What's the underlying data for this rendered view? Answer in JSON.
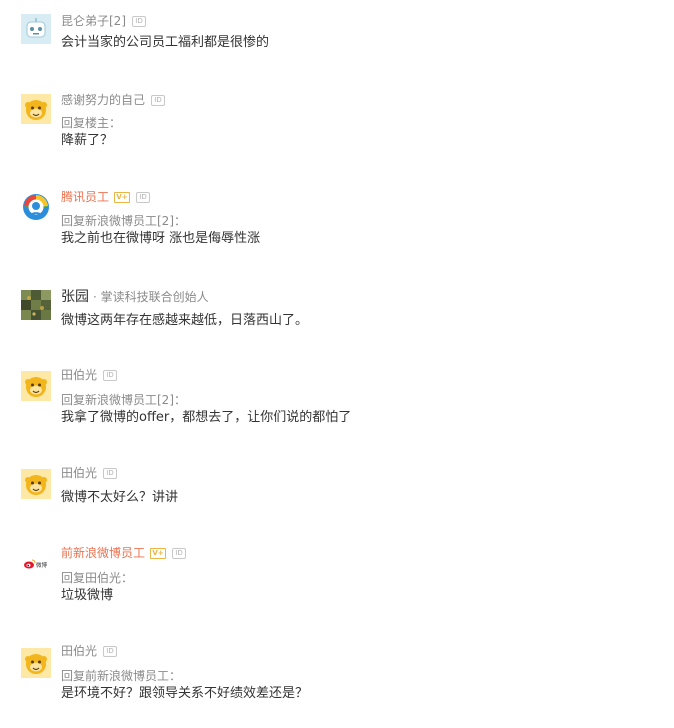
{
  "comments": [
    {
      "avatar_icon": "robot-face-icon",
      "username": "昆仑弟子[2]",
      "id_badge": "ID",
      "content": "会计当家的公司员工福利都是很惨的"
    },
    {
      "avatar_icon": "yellow-monkey-icon",
      "username": "感谢努力的自己",
      "id_badge": "ID",
      "reply_prefix": "回复楼主：",
      "content": "降薪了？"
    },
    {
      "avatar_icon": "tencent-logo-icon",
      "username": "腾讯员工",
      "v_badge": "V+",
      "id_badge": "ID",
      "reply_prefix": "回复新浪微博员工[2]：",
      "content": "我之前也在微博呀 涨也是侮辱性涨"
    },
    {
      "avatar_icon": "photo-thumbnail-icon",
      "username": "张园",
      "title": "· 掌读科技联合创始人",
      "content": "微博这两年存在感越来越低，日落西山了。"
    },
    {
      "avatar_icon": "yellow-monkey-icon",
      "username": "田伯光",
      "id_badge": "ID",
      "reply_prefix": "回复新浪微博员工[2]：",
      "content": "我拿了微博的offer，都想去了，让你们说的都怕了"
    },
    {
      "avatar_icon": "yellow-monkey-icon",
      "username": "田伯光",
      "id_badge": "ID",
      "content": "微博不太好么？讲讲"
    },
    {
      "avatar_icon": "weibo-logo-icon",
      "username": "前新浪微博员工",
      "v_badge": "V+",
      "id_badge": "ID",
      "reply_prefix": "回复田伯光：",
      "content": "垃圾微博",
      "logo_text": "微博"
    },
    {
      "avatar_icon": "yellow-monkey-icon",
      "username": "田伯光",
      "id_badge": "ID",
      "reply_prefix": "回复前新浪微博员工：",
      "content": "是环境不好？跟领导关系不好绩效差还是？"
    }
  ],
  "colors": {
    "text": "#333333",
    "meta": "#8a8a8a",
    "verified_name": "#eb7350",
    "badge_gold": "#e9b545"
  }
}
